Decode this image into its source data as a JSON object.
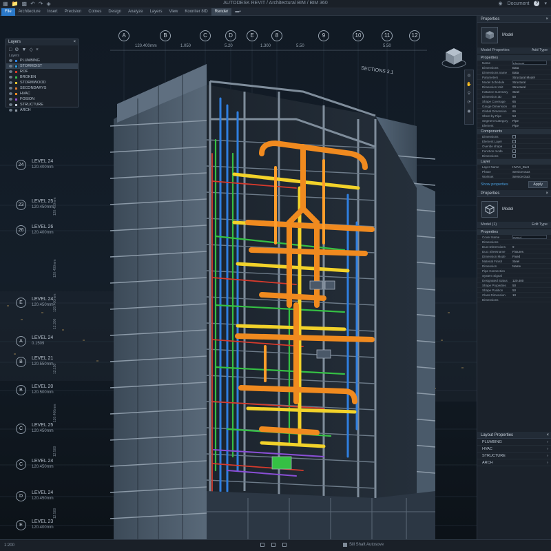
{
  "titlebar": {
    "title": "AUTODESK REVIT / Architectural BIM / BIM 360",
    "user": "Document",
    "help": "?"
  },
  "ribbon": {
    "tabs": [
      "File",
      "Architecture",
      "Insert",
      "Precision",
      "Cotnes",
      "Design",
      "Analyze",
      "Layers",
      "View",
      "Kooniter 8ID",
      "Render",
      "▬▪"
    ]
  },
  "grid": {
    "heads": [
      "A",
      "B",
      "C",
      "D",
      "E",
      "8",
      "9",
      "10",
      "11",
      "12"
    ],
    "dims": [
      "120.400mm",
      "1.050",
      "5.20",
      "1.300",
      "5.50",
      "5.50"
    ],
    "section": "SECTIONS 3.1"
  },
  "levels": [
    {
      "bubble": "24",
      "name": "LEVEL 24",
      "elev": "120.400mm"
    },
    {
      "bubble": "23",
      "name": "LEVEL 25",
      "elev": "120.450mm"
    },
    {
      "bubble": "26",
      "name": "LEVEL 26",
      "elev": "120.400mm"
    },
    {
      "bubble": "E",
      "name": "LEVEL 24",
      "elev": "120.450mm"
    },
    {
      "bubble": "A",
      "name": "LEVEL 24",
      "elev": "0.1509"
    },
    {
      "bubble": "B",
      "name": "LEVEL 21",
      "elev": "120.550mm"
    },
    {
      "bubble": "B",
      "name": "LEVEL 20",
      "elev": "120.500mm"
    },
    {
      "bubble": "C",
      "name": "LEVEL 25",
      "elev": "120.450mm"
    },
    {
      "bubble": "C",
      "name": "LEVEL 24",
      "elev": "120.450mm"
    },
    {
      "bubble": "D",
      "name": "LEVEL 24",
      "elev": "120.450mm"
    },
    {
      "bubble": "E",
      "name": "LEVEL 23",
      "elev": "120.400mm"
    }
  ],
  "vdims": [
    "120.400mm",
    "120.400mm",
    "12.300",
    "120.400mm",
    "12.150",
    "120.400mm",
    "12.500",
    "12.500"
  ],
  "layers_panel": {
    "title": "Layers",
    "sub": "Layers",
    "items": [
      {
        "name": "PLUMBING",
        "color": "#2f7fe0",
        "selected": false
      },
      {
        "name": "STORMDIST",
        "color": "#2fa0e0",
        "selected": true
      },
      {
        "name": "ROF",
        "color": "#d23b2b",
        "selected": false
      },
      {
        "name": "BROKEN",
        "color": "#3bbf4a",
        "selected": false
      },
      {
        "name": "STORMWOOD",
        "color": "#e0c02f",
        "selected": false
      },
      {
        "name": "SECONDARYS",
        "color": "#e07a2f",
        "selected": false
      },
      {
        "name": "HVAC",
        "color": "#f08a1f",
        "selected": false
      },
      {
        "name": "FOSION",
        "color": "#9a4fd0",
        "selected": false
      },
      {
        "name": "STRUCTURE",
        "color": "#b8c3cf",
        "selected": false
      },
      {
        "name": "ARCH",
        "color": "#8e9aa7",
        "selected": false
      }
    ]
  },
  "properties_top": {
    "title": "Properties",
    "type_name": "Model",
    "selector": "Model Properties",
    "selector_right": "Add Type",
    "group1": "Properties",
    "rows": [
      {
        "k": "Name",
        "v": "Element",
        "boxed": true
      },
      {
        "k": "Dimensions",
        "v": "Bata"
      },
      {
        "k": "Dimensions name",
        "v": "Bata"
      },
      {
        "k": "Parameters",
        "v": "Structural Model"
      },
      {
        "k": "Model Schedule",
        "v": "Structural"
      },
      {
        "k": "Dimension Unit",
        "v": "Structural"
      },
      {
        "k": "Instance Summary",
        "v": "Steel"
      },
      {
        "k": "Dimension 3D",
        "v": "50"
      },
      {
        "k": "Shape Coverage",
        "v": "65"
      },
      {
        "k": "Gauge Dimension",
        "v": "60"
      },
      {
        "k": "Global Dimension",
        "v": "65"
      },
      {
        "k": "Sheet by Pipe",
        "v": "53"
      },
      {
        "k": "Segment Category",
        "v": "Pipe"
      },
      {
        "k": "Element",
        "v": "Pipe"
      }
    ],
    "group2": "Components",
    "checks": [
      "Dimensions",
      "Element Layer",
      "Overide shape",
      "Function mode",
      "Dimensions"
    ],
    "group3": "Layer",
    "layer_rows": [
      {
        "k": "Layer Name",
        "v": "HVAC_Duct"
      },
      {
        "k": "Phase",
        "v": "Service Duct"
      },
      {
        "k": "Workset",
        "v": "Service Duct"
      }
    ],
    "link": "Show properties",
    "apply": "Apply"
  },
  "properties_bottom": {
    "title": "Properties",
    "type_name": "Model",
    "selector": "Model (1)",
    "selector_right": "Edit Type",
    "group1": "Properties",
    "rows": [
      {
        "k": "Cover Name",
        "v": "OOnd",
        "boxed": true
      },
      {
        "k": "Dimensions",
        "v": ""
      },
      {
        "k": "Duct Dimensions",
        "v": "9"
      },
      {
        "k": "Duct Sheetname",
        "v": "Fixtures"
      },
      {
        "k": "Dimension Mode",
        "v": "Fixed"
      },
      {
        "k": "Material Finish",
        "v": "Steel"
      },
      {
        "k": "Dimension",
        "v": "Name"
      },
      {
        "k": "Pipe Connection",
        "v": ""
      },
      {
        "k": "System Signal",
        "v": ""
      },
      {
        "k": "Designated Status",
        "v": "120.400"
      },
      {
        "k": "Shape Properties",
        "v": "50"
      },
      {
        "k": "Shape Position",
        "v": "50"
      },
      {
        "k": "Class Dimension",
        "v": "10"
      },
      {
        "k": "Dimensions",
        "v": ""
      }
    ]
  },
  "layer_properties": {
    "title": "Layout Properties",
    "items": [
      "PLUMBING",
      "HVAC",
      "STRUCTURE",
      "ARCH"
    ]
  },
  "status": {
    "zoom": "1:200",
    "model": "Sill Shaft Autosove"
  },
  "colors": {
    "hvac": "#f08a1f",
    "plumbing": "#2f7fe0",
    "yellow": "#f2d22a",
    "green": "#35c044",
    "red": "#d63a2c",
    "purple": "#8a4fd6"
  }
}
